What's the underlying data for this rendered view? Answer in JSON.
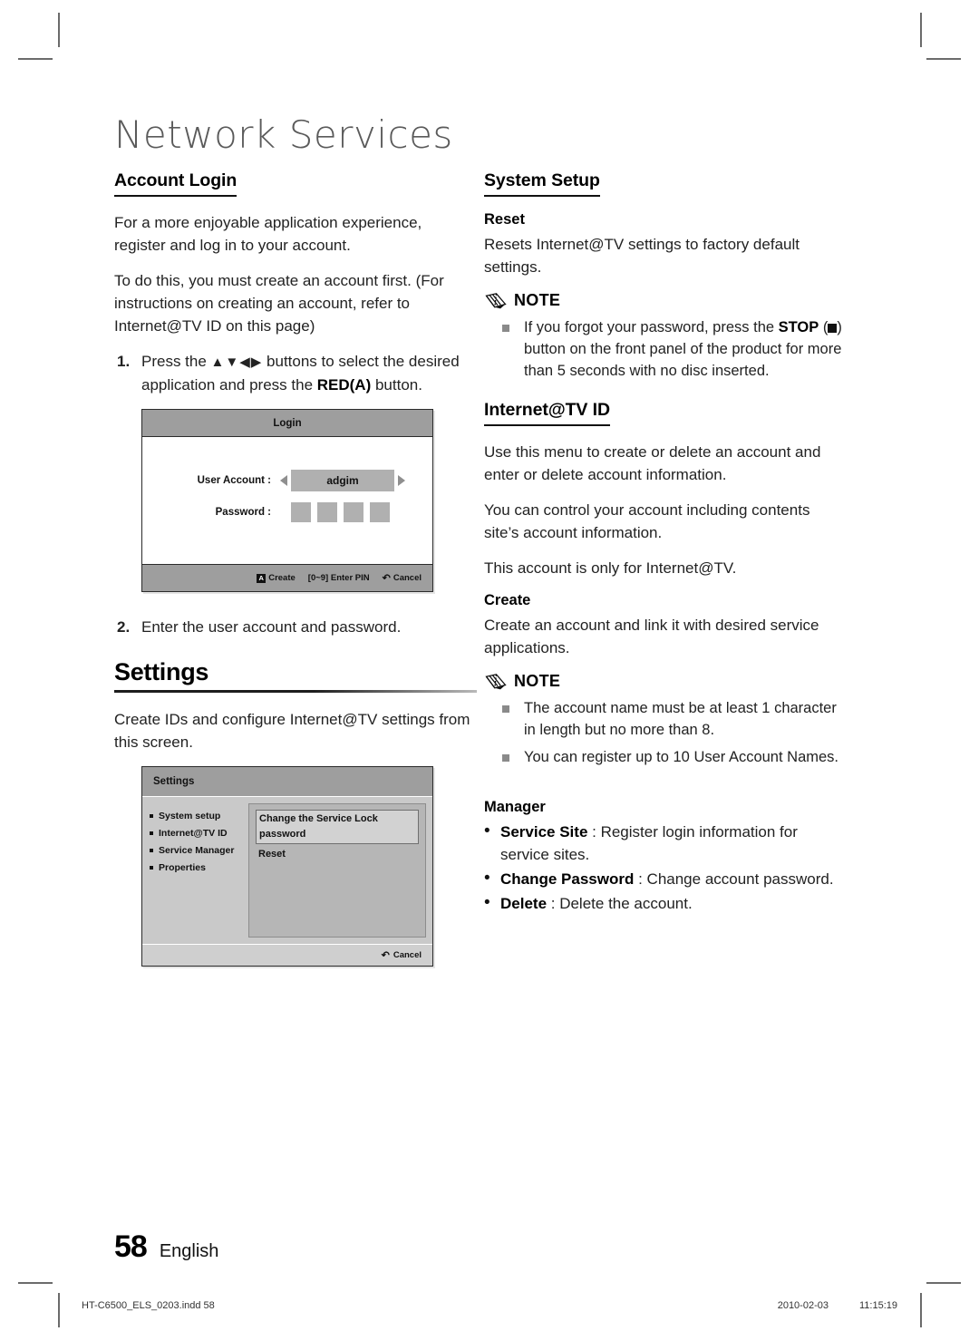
{
  "chapter": {
    "title": "Network Services"
  },
  "left": {
    "account_login": {
      "heading": "Account Login",
      "p1": "For a more enjoyable application experience, register and log in to your account.",
      "p2": "To do this, you must create an account first. (For instructions on creating an account, refer to Internet@TV ID on this page)",
      "step1_num": "1.",
      "step1_a": "Press the ",
      "step1_arrows": "▲▼◀▶",
      "step1_b": " buttons to select the desired application and press the ",
      "step1_bold": "RED(A)",
      "step1_c": " button.",
      "step2_num": "2.",
      "step2_text": "Enter the user account and password."
    },
    "login_shot": {
      "title": "Login",
      "user_account_label": "User Account :",
      "user_account_value": "adgim",
      "password_label": "Password :",
      "password_mask_count": 4,
      "foot_create_key": "A",
      "foot_create_label": "Create",
      "foot_pin": "[0~9] Enter PIN",
      "foot_return_glyph": "↶",
      "foot_cancel_label": "Cancel"
    },
    "settings": {
      "heading": "Settings",
      "p1": "Create IDs and configure Internet@TV settings from this screen."
    },
    "settings_shot": {
      "title": "Settings",
      "nav": [
        "System setup",
        "Internet@TV ID",
        "Service Manager",
        "Properties"
      ],
      "pane": [
        "Change the Service Lock password",
        "Reset"
      ],
      "foot_return_glyph": "↶",
      "foot_cancel_label": "Cancel"
    }
  },
  "right": {
    "system_setup": {
      "heading": "System Setup",
      "reset_heading": "Reset",
      "reset_text": "Resets Internet@TV settings to factory default settings."
    },
    "note1": {
      "label": "NOTE",
      "item_a": "If you forgot your password, press the ",
      "item_a_bold": "STOP",
      "item_a_tail": ") button on the front panel of the product for more than 5 seconds with no disc inserted."
    },
    "internet_tv_id": {
      "heading": "Internet@TV ID",
      "p1": "Use this menu to create or delete an account and enter or delete account information.",
      "p2": "You can control your account including contents site’s account information.",
      "p3": "This account is only for Internet@TV.",
      "create_heading": "Create",
      "create_text": "Create an account and link it with desired service applications."
    },
    "note2": {
      "label": "NOTE",
      "items": [
        "The account name must be at least 1 character in length but no more than 8.",
        "You can register up to 10 User Account Names."
      ]
    },
    "manager": {
      "heading": "Manager",
      "items": [
        {
          "term": "Service Site",
          "desc": " : Register login information for service sites."
        },
        {
          "term": "Change Password",
          "desc": " : Change account password."
        },
        {
          "term": "Delete",
          "desc": " : Delete the account."
        }
      ]
    }
  },
  "footer": {
    "page_number": "58",
    "language": "English",
    "file_name": "HT-C6500_ELS_0203.indd   58",
    "date": "2010-02-03",
    "time": "11:15:19"
  },
  "colors": {
    "title_gray": "#5a5a5a",
    "screenshot_header_gray": "#9e9e9e",
    "screenshot_field_gray": "#b0b0b0",
    "settings_body_gray": "#c9c9c9",
    "note_bullet_gray": "#8a8a8a"
  }
}
